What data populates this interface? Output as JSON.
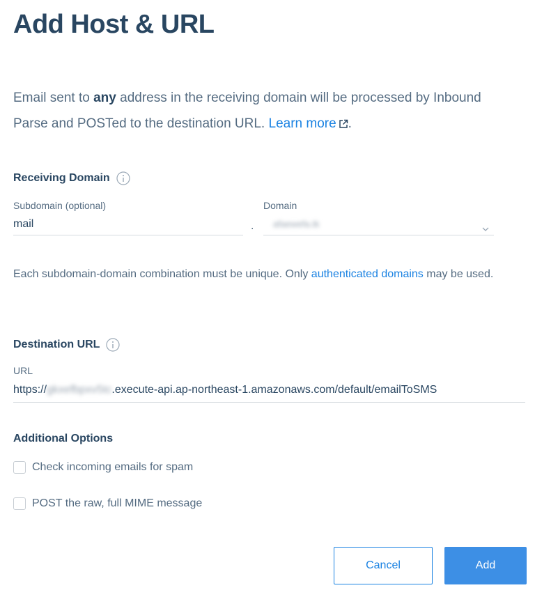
{
  "dialog": {
    "title": "Add Host & URL"
  },
  "intro": {
    "part1": "Email sent to ",
    "bold": "any",
    "part2": " address in the receiving domain will be processed by Inbound Parse and POSTed to the destination URL. ",
    "link": "Learn more",
    "end": "."
  },
  "receiving": {
    "heading": "Receiving Domain",
    "subdomain_label": "Subdomain (optional)",
    "subdomain_value": "mail",
    "separator": ".",
    "domain_label": "Domain",
    "domain_value": "afaewefa.tk"
  },
  "help": {
    "part1": "Each subdomain-domain combination must be unique. Only ",
    "link": "authenticated domains",
    "part2": " may be used."
  },
  "destination": {
    "heading": "Destination URL",
    "url_label": "URL",
    "url_prefix": "https://",
    "url_hidden": "gkxefbpxv5tc",
    "url_suffix": ".execute-api.ap-northeast-1.amazonaws.com/default/emailToSMS"
  },
  "options": {
    "heading": "Additional Options",
    "spam_label": "Check incoming emails for spam",
    "raw_label": "POST the raw, full MIME message"
  },
  "buttons": {
    "cancel": "Cancel",
    "add": "Add"
  },
  "colors": {
    "heading": "#294661",
    "text": "#546b81",
    "link": "#1a82e2",
    "primary": "#3d8fe5"
  }
}
